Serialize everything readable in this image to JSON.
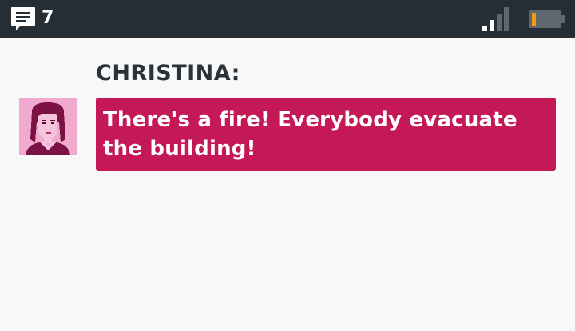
{
  "status_bar": {
    "notification_count": "7",
    "icons": [
      "message-icon",
      "signal-icon",
      "battery-low-icon"
    ],
    "colors": {
      "background": "#262e35",
      "battery_level": "#f39c12"
    }
  },
  "dialog": {
    "speaker": "CHRISTINA:",
    "message": "There's a fire! Everybody evacuate the building!",
    "avatar": "christina-portrait",
    "colors": {
      "bubble": "#c51857",
      "avatar_bg": "#f2a9cf",
      "speaker": "#2a3138"
    }
  }
}
